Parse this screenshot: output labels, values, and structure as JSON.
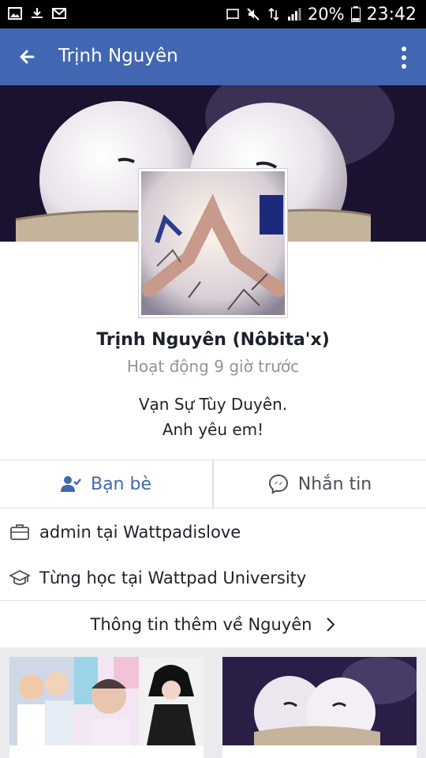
{
  "status_bar": {
    "battery_percent": "20%",
    "time": "23:42",
    "left_icons": [
      "gallery-icon",
      "download-icon",
      "mail-icon"
    ],
    "right_icons": [
      "cast-icon",
      "mute-icon",
      "data-icon",
      "signal-icon",
      "battery-icon"
    ]
  },
  "app_bar": {
    "title": "Trịnh Nguyên",
    "back_icon": "arrow-left-icon",
    "menu_icon": "more-vert-icon",
    "color": "#4267b2"
  },
  "profile": {
    "name": "Trịnh Nguyên (Nôbita'x)",
    "activity": "Hoạt động 9 giờ trước",
    "bio_line_1": "Vạn Sự Tùy Duyên.",
    "bio_line_2": "Anh yêu em!"
  },
  "actions": {
    "friends_label": "Bạn bè",
    "message_label": "Nhắn tin"
  },
  "info": {
    "work": "admin tại Wattpadislove",
    "education": "Từng học tại Wattpad University",
    "more_label": "Thông tin thêm về Nguyên"
  },
  "colors": {
    "accent": "#4267b2",
    "muted_text": "#90949c",
    "divider": "#dddfe2",
    "background_gray": "#e9ebee"
  }
}
